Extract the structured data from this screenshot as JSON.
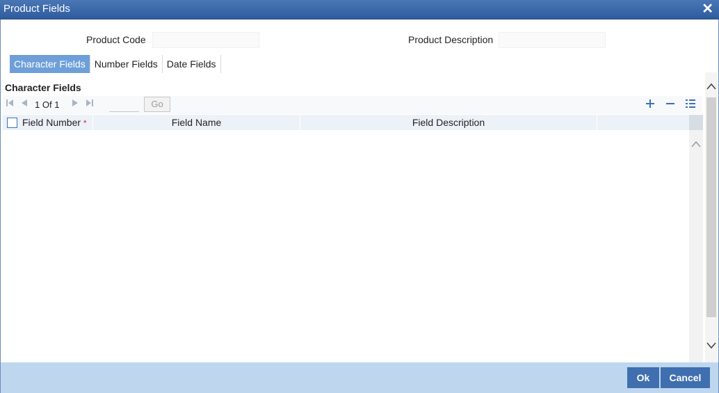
{
  "window": {
    "title": "Product Fields",
    "close_glyph": "✕"
  },
  "header": {
    "product_code_label": "Product Code",
    "product_code_value": "",
    "product_description_label": "Product Description",
    "product_description_value": ""
  },
  "tabs": [
    {
      "label": "Character Fields",
      "active": true
    },
    {
      "label": "Number Fields",
      "active": false
    },
    {
      "label": "Date Fields",
      "active": false
    }
  ],
  "section": {
    "title": "Character Fields"
  },
  "pager": {
    "current": "1",
    "of_label": "Of",
    "total": "1",
    "page_input": "",
    "go_label": "Go"
  },
  "grid": {
    "columns": [
      {
        "label": "Field Number",
        "required_marker": "*"
      },
      {
        "label": "Field Name"
      },
      {
        "label": "Field Description"
      }
    ],
    "rows": []
  },
  "footer": {
    "ok_label": "Ok",
    "cancel_label": "Cancel"
  },
  "colors": {
    "title_bar": "#2f5c9e",
    "active_tab": "#6e9fd9",
    "button": "#3f6fae",
    "footer": "#bed7ee"
  },
  "icons": [
    "close-icon",
    "first-page-icon",
    "prev-page-icon",
    "next-page-icon",
    "last-page-icon",
    "add-row-icon",
    "delete-row-icon",
    "single-view-icon",
    "scroll-up-icon",
    "scroll-down-icon"
  ]
}
